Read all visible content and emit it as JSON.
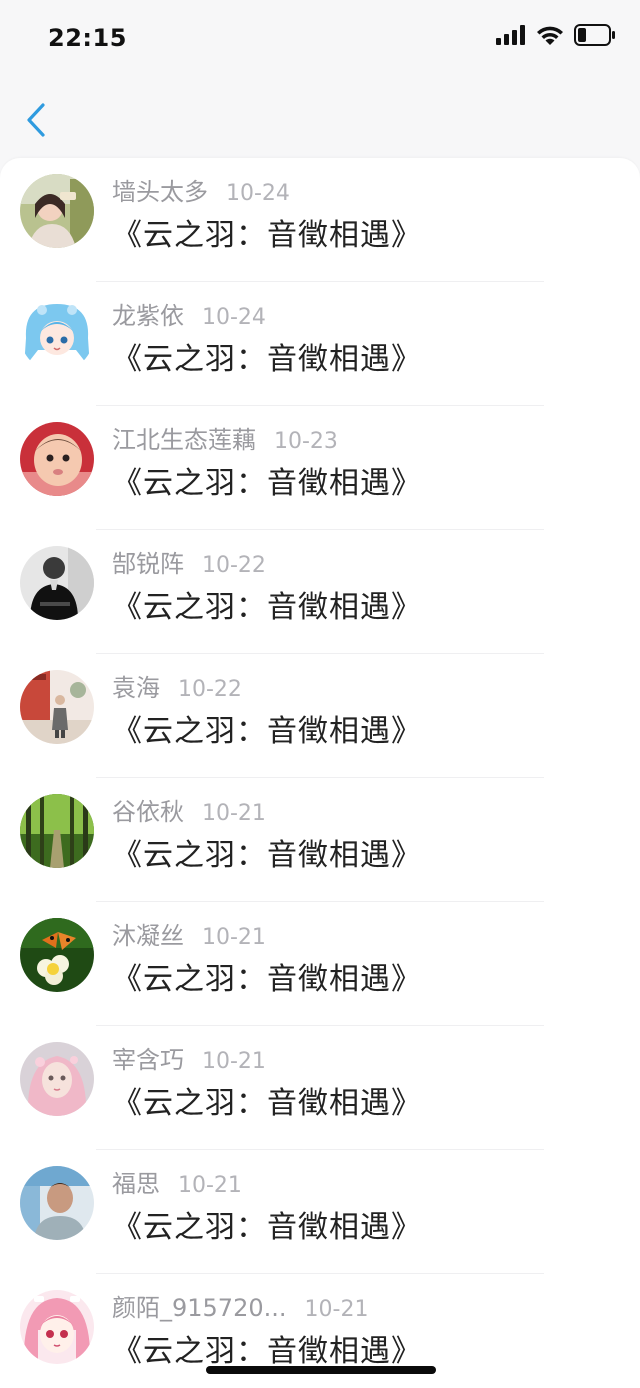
{
  "status_bar": {
    "time": "22:15",
    "icons": [
      "cellular-signal-icon",
      "wifi-icon",
      "battery-icon"
    ]
  },
  "nav": {
    "back_icon": "chevron-left-icon",
    "accent_color": "#2f9bdf"
  },
  "list": {
    "items": [
      {
        "user": "墙头太多",
        "date": "10-24",
        "title": "《云之羽：音徵相遇》",
        "avatar": "avatar-photo-girl"
      },
      {
        "user": "龙紫依",
        "date": "10-24",
        "title": "《云之羽：音徵相遇》",
        "avatar": "avatar-anime-blue-hair"
      },
      {
        "user": "江北生态莲藕",
        "date": "10-23",
        "title": "《云之羽：音徵相遇》",
        "avatar": "avatar-photo-baby"
      },
      {
        "user": "郜锐阵",
        "date": "10-22",
        "title": "《云之羽：音徵相遇》",
        "avatar": "avatar-photo-black-white"
      },
      {
        "user": "袁海",
        "date": "10-22",
        "title": "《云之羽：音徵相遇》",
        "avatar": "avatar-photo-courtyard"
      },
      {
        "user": "谷依秋",
        "date": "10-21",
        "title": "《云之羽：音徵相遇》",
        "avatar": "avatar-photo-forest"
      },
      {
        "user": "沐凝丝",
        "date": "10-21",
        "title": "《云之羽：音徵相遇》",
        "avatar": "avatar-photo-butterfly-flower"
      },
      {
        "user": "宰含巧",
        "date": "10-21",
        "title": "《云之羽：音徵相遇》",
        "avatar": "avatar-illustration-pink-girl"
      },
      {
        "user": "福思",
        "date": "10-21",
        "title": "《云之羽：音徵相遇》",
        "avatar": "avatar-photo-man"
      },
      {
        "user": "颜陌_915720...",
        "date": "10-21",
        "title": "《云之羽：音徵相遇》",
        "avatar": "avatar-anime-pink-hair"
      }
    ]
  }
}
